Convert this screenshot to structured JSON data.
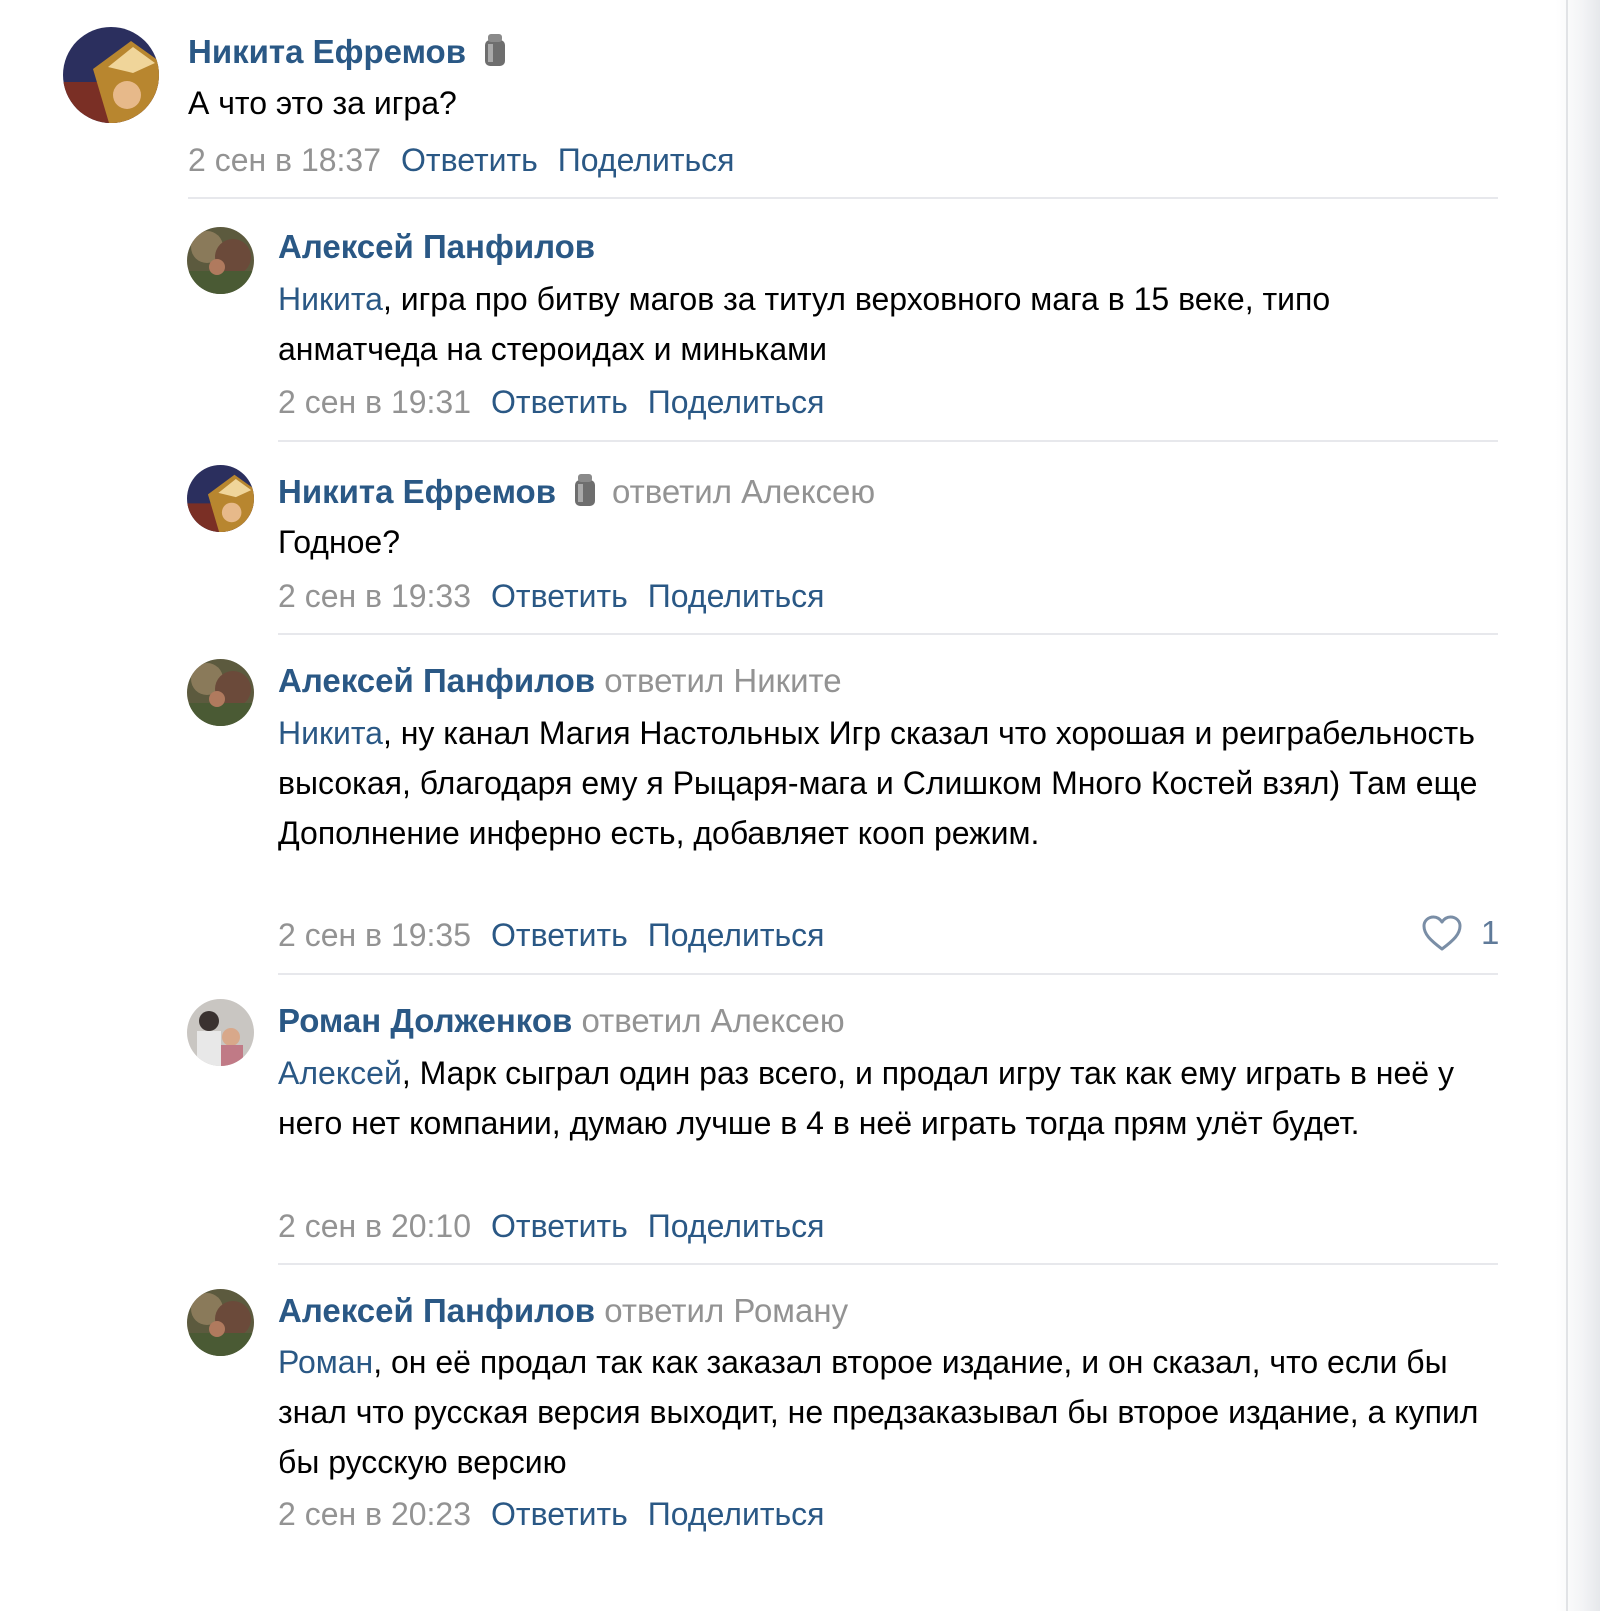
{
  "comments": [
    {
      "author": "Никита Ефремов",
      "badge_icon": "gift-icon",
      "replied": "",
      "mention": "",
      "text": "А что это за игра?",
      "date": "2 сен в 18:37",
      "reply": "Ответить",
      "share": "Поделиться"
    },
    {
      "author": "Алексей Панфилов",
      "replied": "",
      "mention": "Никита",
      "text": ", игра про битву магов за титул верховного мага в 15 веке, типо анматчеда на стероидах и миньками",
      "date": "2 сен в 19:31",
      "reply": "Ответить",
      "share": "Поделиться"
    },
    {
      "author": "Никита Ефремов",
      "badge_icon": "gift-icon",
      "replied": "ответил Алексею",
      "mention": "",
      "text": "Годное?",
      "date": "2 сен в 19:33",
      "reply": "Ответить",
      "share": "Поделиться"
    },
    {
      "author": "Алексей Панфилов",
      "replied": "ответил Никите",
      "mention": "Никита",
      "text": ", ну канал Магия Настольных Игр сказал что хорошая и реиграбельность высокая, благодаря ему я Рыцаря-мага и Слишком Много Костей взял) Там еще Дополнение инферно есть, добавляет кооп режим.",
      "date": "2 сен в 19:35",
      "reply": "Ответить",
      "share": "Поделиться",
      "likes": "1",
      "like_icon": "heart-icon"
    },
    {
      "author": "Роман Долженков",
      "replied": "ответил Алексею",
      "mention": "Алексей",
      "text": ", Марк сыграл один раз всего, и продал игру так как ему играть в неё у него нет компании, думаю лучше в 4 в неё играть тогда прям улёт будет.",
      "date": "2 сен в 20:10",
      "reply": "Ответить",
      "share": "Поделиться"
    },
    {
      "author": "Алексей Панфилов",
      "replied": "ответил Роману",
      "mention": "Роман",
      "text": ", он её продал так как заказал второе издание, и он сказал, что если бы знал что русская версия выходит, не предзаказывал бы второе издание, а купил бы русскую версию",
      "date": "2 сен в 20:23",
      "reply": "Ответить",
      "share": "Поделиться"
    }
  ],
  "colors": {
    "link": "#2a5885",
    "meta": "#939393",
    "divider": "#e7e8ec"
  }
}
